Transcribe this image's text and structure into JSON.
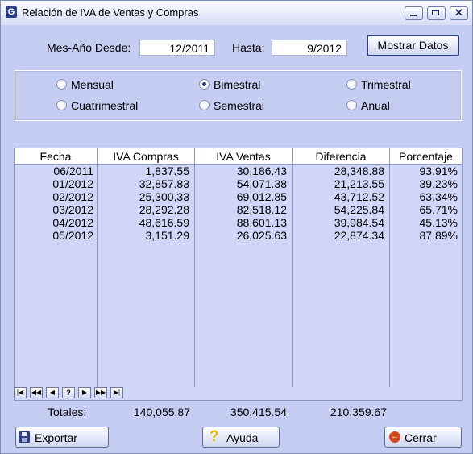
{
  "window": {
    "title": "Relación de IVA de Ventas y Compras",
    "app_icon_glyph": "G",
    "controls": [
      "minimize-icon",
      "maximize-icon",
      "close-icon"
    ]
  },
  "filters": {
    "desde_label": "Mes-Año Desde:",
    "desde_value": "12/2011",
    "hasta_label": "Hasta:",
    "hasta_value": "9/2012",
    "show_button": "Mostrar Datos"
  },
  "periods": {
    "options": [
      "Mensual",
      "Bimestral",
      "Trimestral",
      "Cuatrimestral",
      "Semestral",
      "Anual"
    ],
    "selected": "Bimestral"
  },
  "table": {
    "columns": [
      "Fecha",
      "IVA Compras",
      "IVA Ventas",
      "Diferencia",
      "Porcentaje"
    ],
    "rows": [
      [
        "06/2011",
        "1,837.55",
        "30,186.43",
        "28,348.88",
        "93.91%"
      ],
      [
        "01/2012",
        "32,857.83",
        "54,071.38",
        "21,213.55",
        "39.23%"
      ],
      [
        "02/2012",
        "25,300.33",
        "69,012.85",
        "43,712.52",
        "63.34%"
      ],
      [
        "03/2012",
        "28,292.28",
        "82,518.12",
        "54,225.84",
        "65.71%"
      ],
      [
        "04/2012",
        "48,616.59",
        "88,601.13",
        "39,984.54",
        "45.13%"
      ],
      [
        "05/2012",
        "3,151.29",
        "26,025.63",
        "22,874.34",
        "87.89%"
      ]
    ],
    "navigator": [
      "first-icon",
      "prior-page-icon",
      "prior-icon",
      "help-icon",
      "next-icon",
      "next-page-icon",
      "last-icon"
    ]
  },
  "totals": {
    "label": "Totales:",
    "compras": "140,055.87",
    "ventas": "350,415.54",
    "diferencia": "210,359.67"
  },
  "buttons": {
    "exportar": "Exportar",
    "ayuda": "Ayuda",
    "cerrar": "Cerrar"
  },
  "colors": {
    "window_bg": "#c6cdf2",
    "grid_bg": "#cfd6f8",
    "accent": "#2b3f86",
    "close_icon": "#d04a1f",
    "help_icon": "#e8b400"
  }
}
